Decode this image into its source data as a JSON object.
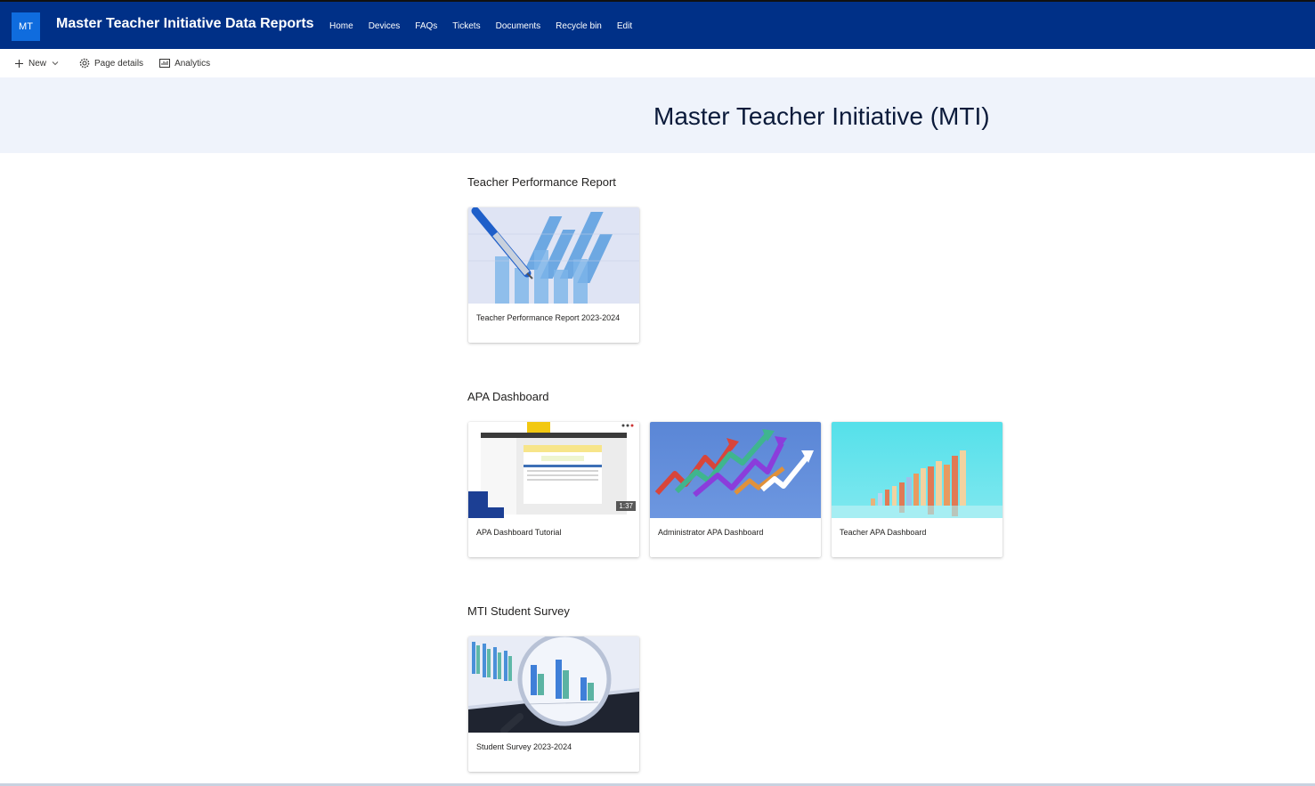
{
  "header": {
    "logo_text": "MT",
    "site_title": "Master Teacher Initiative Data Reports",
    "nav": [
      "Home",
      "Devices",
      "FAQs",
      "Tickets",
      "Documents",
      "Recycle bin",
      "Edit"
    ],
    "bg_color": "#003087",
    "logo_color": "#0f6cde"
  },
  "command_bar": {
    "new_label": "New",
    "page_details_label": "Page details",
    "analytics_label": "Analytics",
    "icons": [
      "add-icon",
      "chevron-down-icon",
      "gear-icon",
      "analytics-icon"
    ]
  },
  "title_band": {
    "title": "Master Teacher Initiative (MTI)",
    "bg_color": "#eff3fb"
  },
  "sections": [
    {
      "heading": "Teacher Performance Report",
      "cards": [
        {
          "label": "Teacher Performance Report 2023-2024",
          "thumbnail": "pen-on-bar-chart"
        }
      ]
    },
    {
      "heading": "APA Dashboard",
      "cards": [
        {
          "label": "APA Dashboard Tutorial",
          "thumbnail": "video-screen-capture",
          "duration": "1:37"
        },
        {
          "label": "Administrator APA Dashboard",
          "thumbnail": "rising-arrows"
        },
        {
          "label": "Teacher APA Dashboard",
          "thumbnail": "3d-bar-chart"
        }
      ]
    },
    {
      "heading": "MTI Student Survey",
      "cards": [
        {
          "label": "Student Survey 2023-2024",
          "thumbnail": "magnifier-over-chart"
        }
      ]
    }
  ]
}
